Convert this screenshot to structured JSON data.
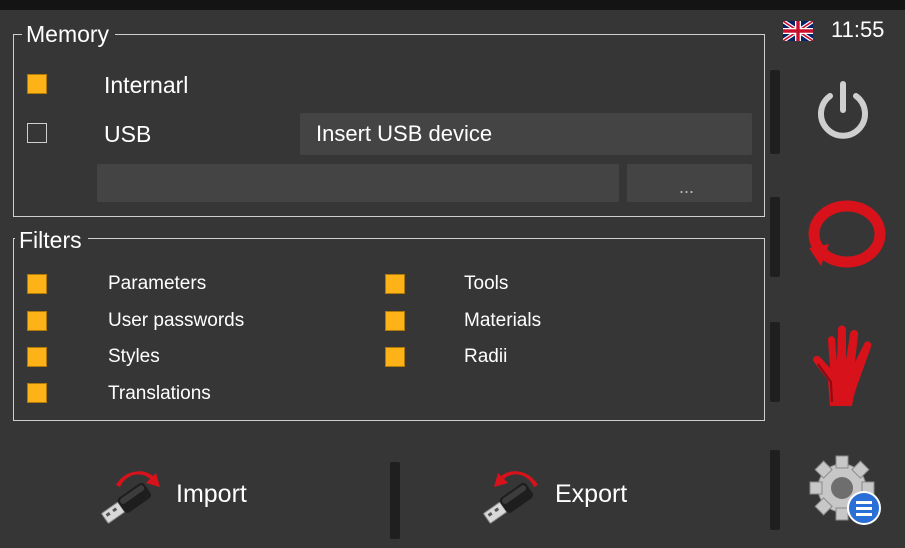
{
  "status": {
    "time": "11:55",
    "language_flag": "uk-flag-icon"
  },
  "memory": {
    "title": "Memory",
    "internal": {
      "label": "Internarl",
      "checked": true
    },
    "usb": {
      "label": "USB",
      "checked": false,
      "status": "Insert USB device"
    },
    "path_value": "",
    "browse_label": "..."
  },
  "filters": {
    "title": "Filters",
    "items": [
      {
        "label": "Parameters",
        "checked": true
      },
      {
        "label": "User passwords",
        "checked": true
      },
      {
        "label": "Styles",
        "checked": true
      },
      {
        "label": "Translations",
        "checked": true
      },
      {
        "label": "Tools",
        "checked": true
      },
      {
        "label": "Materials",
        "checked": true
      },
      {
        "label": "Radii",
        "checked": true
      }
    ]
  },
  "actions": {
    "import_label": "Import",
    "export_label": "Export"
  },
  "sidebar": {
    "icons": [
      "power-icon",
      "reset-icon",
      "stop-hand-icon",
      "settings-icon"
    ]
  },
  "colors": {
    "background": "#363636",
    "checkbox_on": "#fdb318",
    "accent_red": "#d8121a",
    "field": "#444444"
  }
}
